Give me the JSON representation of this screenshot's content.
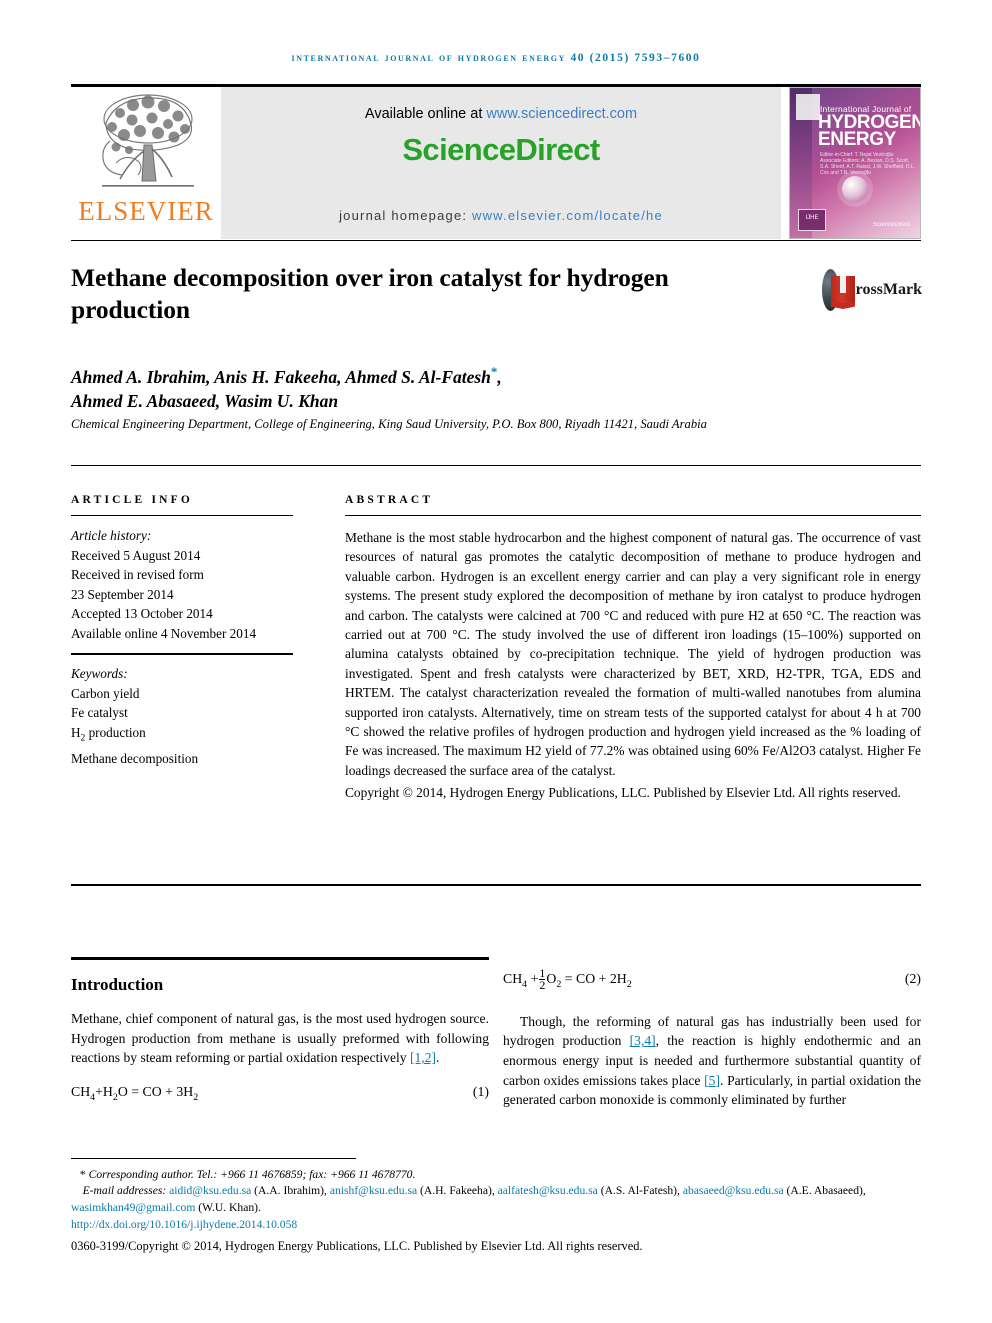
{
  "running_head": "International Journal of Hydrogen Energy 40 (2015) 7593–7600",
  "header": {
    "publisher_name": "ELSEVIER",
    "available_prefix": "Available online at ",
    "available_url": "www.sciencedirect.com",
    "sciencedirect_logo": "ScienceDirect",
    "homepage_label": "journal homepage: ",
    "homepage_url": "www.elsevier.com/locate/he",
    "cover": {
      "line1": "International Journal of",
      "line2": "HYDROGEN ENERGY",
      "editors": "Editor-in-Chief: T. Nejat Veziroğlu   Associate Editors: A. Bezian, D.S. Scott, S.A. Sherif, A.T. Raissi, J.W. Sheffield, D.L. Cox and T.N. Veziroğlu",
      "badge": "IJHE",
      "sciencedirect": "ScienceDirect"
    },
    "colors": {
      "link": "#3b7fc4",
      "sciencedirect_green": "#27a327",
      "elsevier_orange": "#ef7d22",
      "running_head_blue": "#0b7ba8"
    }
  },
  "article": {
    "title": "Methane decomposition over iron catalyst for hydrogen production",
    "crossmark_label": "CrossMark",
    "authors_line1": "Ahmed A. Ibrahim, Anis H. Fakeeha, Ahmed S. Al-Fatesh",
    "authors_star": "*",
    "authors_line1_tail": ",",
    "authors_line2": "Ahmed E. Abasaeed, Wasim U. Khan",
    "affiliation": "Chemical Engineering Department, College of Engineering, King Saud University, P.O. Box 800, Riyadh 11421, Saudi Arabia"
  },
  "article_info": {
    "heading": "ARTICLE INFO",
    "history_label": "Article history:",
    "history": [
      "Received 5 August 2014",
      "Received in revised form",
      "23 September 2014",
      "Accepted 13 October 2014",
      "Available online 4 November 2014"
    ],
    "keywords_label": "Keywords:",
    "keywords": [
      "Carbon yield",
      "Fe catalyst",
      "H2 production",
      "Methane decomposition"
    ]
  },
  "abstract": {
    "heading": "ABSTRACT",
    "body": "Methane is the most stable hydrocarbon and the highest component of natural gas. The occurrence of vast resources of natural gas promotes the catalytic decomposition of methane to produce hydrogen and valuable carbon. Hydrogen is an excellent energy carrier and can play a very significant role in energy systems. The present study explored the decomposition of methane by iron catalyst to produce hydrogen and carbon. The catalysts were calcined at 700 °C and reduced with pure H2 at 650 °C. The reaction was carried out at 700 °C. The study involved the use of different iron loadings (15–100%) supported on alumina catalysts obtained by co-precipitation technique. The yield of hydrogen production was investigated. Spent and fresh catalysts were characterized by BET, XRD, H2-TPR, TGA, EDS and HRTEM. The catalyst characterization revealed the formation of multi-walled nanotubes from alumina supported iron catalysts. Alternatively, time on stream tests of the supported catalyst for about 4 h at 700 °C showed the relative profiles of hydrogen production and hydrogen yield increased as the % loading of Fe was increased. The maximum H2 yield of 77.2% was obtained using 60% Fe/Al2O3 catalyst. Higher Fe loadings decreased the surface area of the catalyst.",
    "copyright": "Copyright © 2014, Hydrogen Energy Publications, LLC. Published by Elsevier Ltd. All rights reserved."
  },
  "body": {
    "section_title": "Introduction",
    "left_para_1": "Methane, chief component of natural gas, is the most used hydrogen source. Hydrogen production from methane is usually preformed with following reactions by steam reforming or partial oxidation respectively ",
    "left_para_1_ref": "[1,2]",
    "left_para_1_end": ".",
    "equation_1_number": "(1)",
    "equation_2_number": "(2)",
    "right_para_1_a": "Though, the reforming of natural gas has industrially been used for hydrogen production ",
    "right_para_1_ref1": "[3,4]",
    "right_para_1_b": ", the reaction is highly endothermic and an enormous energy input is needed and furthermore substantial quantity of carbon oxides emissions takes place ",
    "right_para_1_ref2": "[5]",
    "right_para_1_c": ". Particularly, in partial oxidation the generated carbon monoxide is commonly eliminated by further"
  },
  "footer": {
    "corresponding_star": "*",
    "corresponding": "Corresponding author. Tel.: +966 11 4676859; fax: +966 11 4678770.",
    "email_label": "E-mail addresses: ",
    "emails": [
      {
        "address": "aidid@ksu.edu.sa",
        "person": " (A.A. Ibrahim), "
      },
      {
        "address": "anishf@ksu.edu.sa",
        "person": " (A.H. Fakeeha), "
      },
      {
        "address": "aalfatesh@ksu.edu.sa",
        "person": " (A.S. Al-Fatesh), "
      },
      {
        "address": "abasaeed@ksu.edu.sa",
        "person": " (A.E. Abasaeed), "
      },
      {
        "address": "wasimkhan49@gmail.com",
        "person": " (W.U. Khan)."
      }
    ],
    "doi": "http://dx.doi.org/10.1016/j.ijhydene.2014.10.058",
    "issn_line": "0360-3199/Copyright © 2014, Hydrogen Energy Publications, LLC. Published by Elsevier Ltd. All rights reserved."
  }
}
